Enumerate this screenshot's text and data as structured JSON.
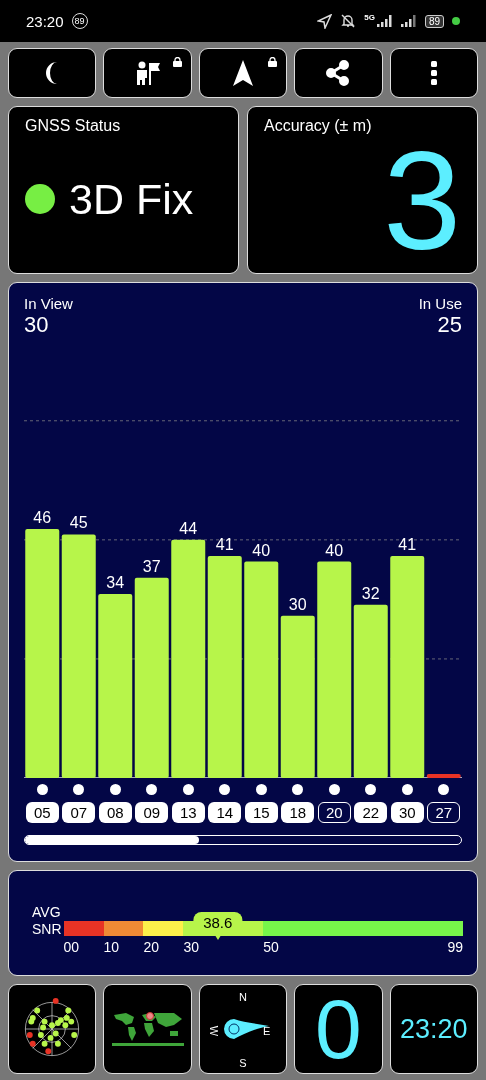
{
  "status_bar": {
    "time": "23:20",
    "notification_badge": "89",
    "network": "5G",
    "battery": "89"
  },
  "toolbar": [
    {
      "kind": "moon",
      "locked": false
    },
    {
      "kind": "person-flag",
      "locked": true
    },
    {
      "kind": "navigation",
      "locked": true
    },
    {
      "kind": "share",
      "locked": false
    },
    {
      "kind": "more",
      "locked": false
    }
  ],
  "gnss_status": {
    "title": "GNSS Status",
    "fix": "3D Fix",
    "color": "#77ee44"
  },
  "accuracy": {
    "title": "Accuracy (± m)",
    "value": "3"
  },
  "satellites": {
    "in_view_label": "In View",
    "in_view": "30",
    "in_use_label": "In Use",
    "in_use": "25",
    "chart_data": {
      "type": "bar",
      "categories": [
        "05",
        "07",
        "08",
        "09",
        "13",
        "14",
        "15",
        "18",
        "20",
        "22",
        "30",
        "27"
      ],
      "values": [
        46,
        45,
        34,
        37,
        44,
        41,
        40,
        30,
        40,
        32,
        41,
        0
      ],
      "value_labels": [
        "46",
        "45",
        "34",
        "37",
        "44",
        "41",
        "40",
        "30",
        "40",
        "32",
        "41",
        null
      ]
    },
    "items": [
      {
        "in_use": true
      },
      {
        "in_use": true
      },
      {
        "in_use": true
      },
      {
        "in_use": true
      },
      {
        "in_use": true
      },
      {
        "in_use": true
      },
      {
        "in_use": true
      },
      {
        "in_use": true
      },
      {
        "in_use": false
      },
      {
        "in_use": true
      },
      {
        "in_use": true
      },
      {
        "in_use": false
      }
    ]
  },
  "snr": {
    "label_1": "AVG",
    "label_2": "SNR",
    "value": "38.6",
    "level": 0.386,
    "segments": [
      {
        "label": "00",
        "color": "#e83325"
      },
      {
        "label": "10",
        "color": "#f08a35"
      },
      {
        "label": "20",
        "color": "#fdf04a"
      },
      {
        "label": "30",
        "color": "#b7f54a"
      },
      {
        "label": "50",
        "color": "#77f54a"
      }
    ],
    "end_label": "99"
  },
  "tiles": [
    {
      "kind": "skyplot"
    },
    {
      "kind": "world-map"
    },
    {
      "kind": "compass",
      "north": "N",
      "east": "E",
      "south": "S",
      "west": "W"
    },
    {
      "kind": "number",
      "text": "0"
    },
    {
      "kind": "clock",
      "text": "23:20"
    }
  ]
}
